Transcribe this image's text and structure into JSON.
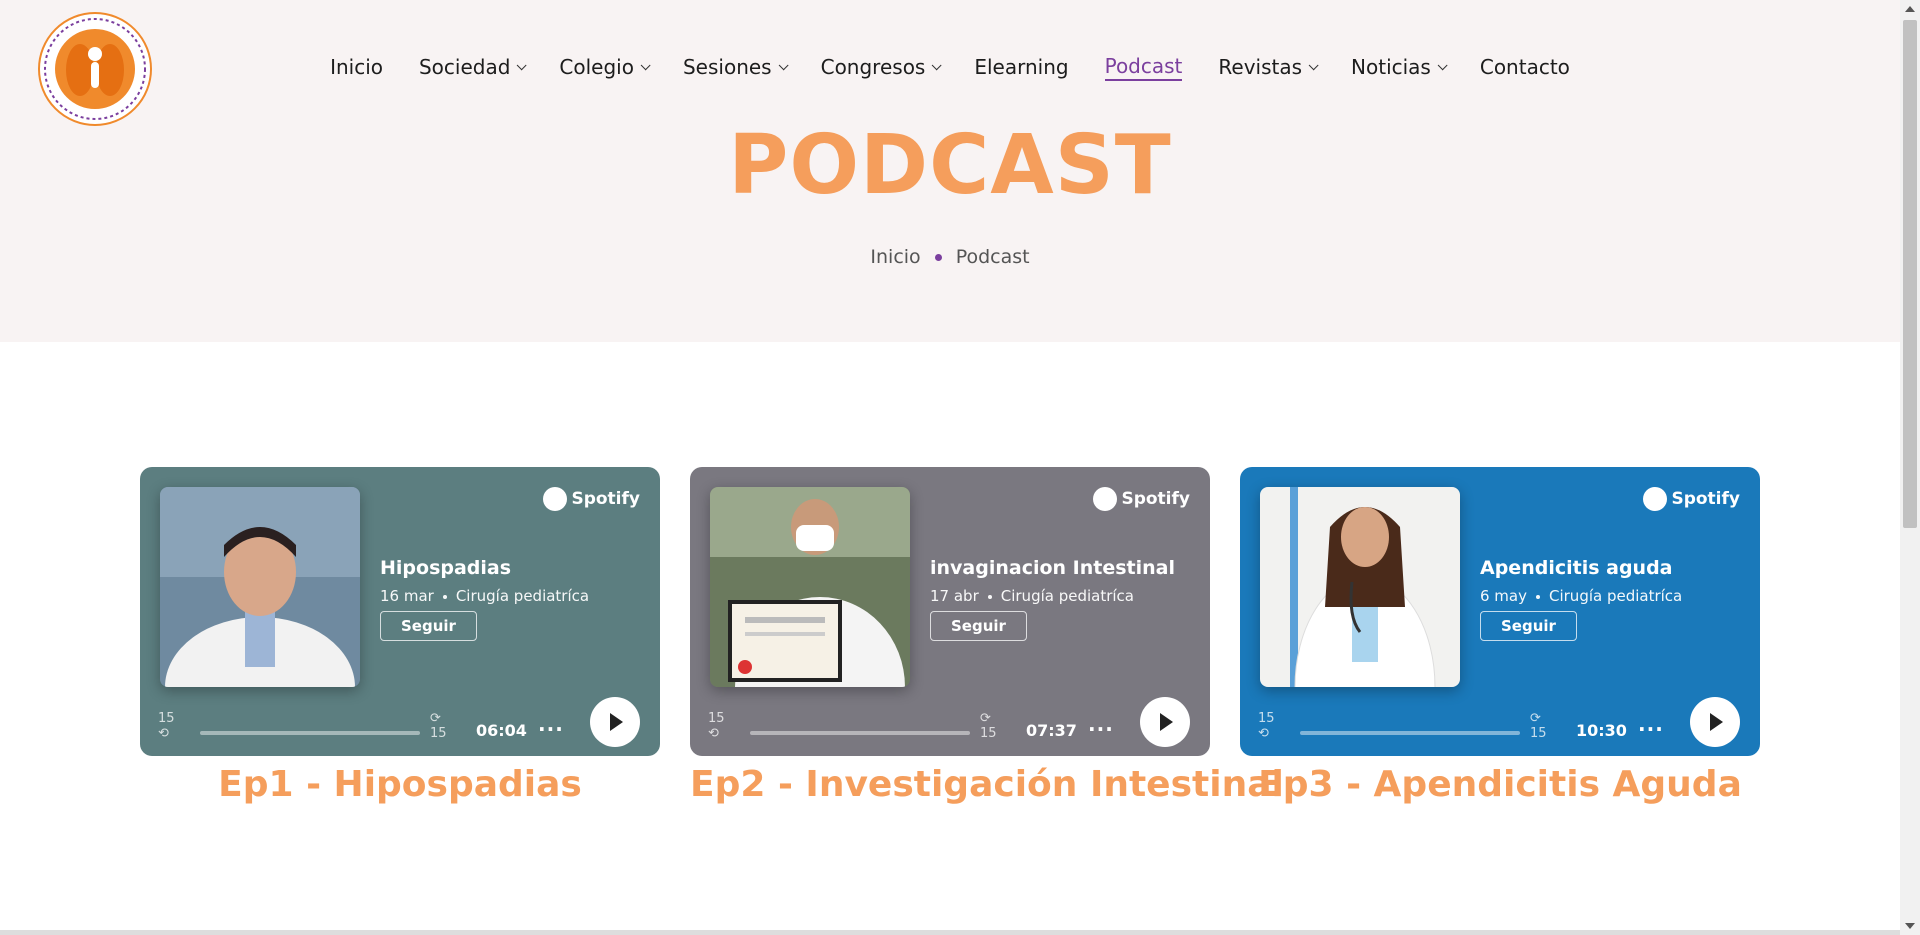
{
  "header": {
    "logo_text": "COLEGIO MEXICANO DE CIRUGÍA PEDIÁTRICA, A.C. · SOCIEDAD MEXICANA DE CIRUGÍA PEDIÁTRICA, A.C.",
    "nav": [
      {
        "label": "Inicio",
        "dropdown": false
      },
      {
        "label": "Sociedad",
        "dropdown": true
      },
      {
        "label": "Colegio",
        "dropdown": true
      },
      {
        "label": "Sesiones",
        "dropdown": true
      },
      {
        "label": "Congresos",
        "dropdown": true
      },
      {
        "label": "Elearning",
        "dropdown": false
      },
      {
        "label": "Podcast",
        "dropdown": false,
        "active": true
      },
      {
        "label": "Revistas",
        "dropdown": true
      },
      {
        "label": "Noticias",
        "dropdown": true
      },
      {
        "label": "Contacto",
        "dropdown": false
      }
    ]
  },
  "hero": {
    "title": "PODCAST",
    "breadcrumb": [
      "Inicio",
      "Podcast"
    ]
  },
  "episodes": [
    {
      "card_bg": "#5c7e80",
      "spotify_label": "Spotify",
      "title": "Hipospadias",
      "date": "16 mar",
      "show": "Cirugía pediatríca",
      "follow_label": "Seguir",
      "skip_back": "15",
      "skip_fwd": "15",
      "duration": "06:04",
      "more": "···",
      "heading": "Ep1 - Hipospadias"
    },
    {
      "card_bg": "#7a7880",
      "spotify_label": "Spotify",
      "title": "invaginacion Intestinal",
      "date": "17 abr",
      "show": "Cirugía pediatríca",
      "follow_label": "Seguir",
      "skip_back": "15",
      "skip_fwd": "15",
      "duration": "07:37",
      "more": "···",
      "heading": "Ep2 - Investigación Intestinal"
    },
    {
      "card_bg": "#1a79ba",
      "spotify_label": "Spotify",
      "title": "Apendicitis aguda",
      "date": "6 may",
      "show": "Cirugía pediatríca",
      "follow_label": "Seguir",
      "skip_back": "15",
      "skip_fwd": "15",
      "duration": "10:30",
      "more": "···",
      "heading": "Ep3 - Apendicitis Aguda"
    }
  ],
  "colors": {
    "accent_orange": "#f59e5c",
    "accent_purple": "#7b3f9e",
    "hero_bg": "#f8f3f3"
  }
}
